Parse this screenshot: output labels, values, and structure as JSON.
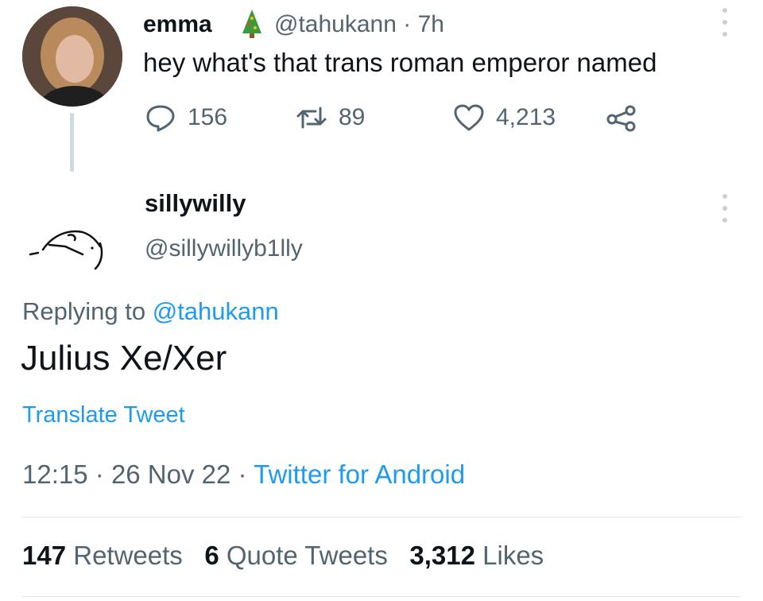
{
  "tweet1": {
    "name": "emma",
    "emoji_icon": "christmas-tree-icon",
    "handle": "@tahukann",
    "separator": "·",
    "age": "7h",
    "text": "hey what's that trans roman emperor named",
    "replies": "156",
    "retweets": "89",
    "likes": "4,213"
  },
  "tweet2": {
    "name": "sillywilly",
    "handle": "@sillywillyb1lly",
    "replying_prefix": "Replying to",
    "replying_handle": "@tahukann",
    "text": "Julius Xe/Xer",
    "translate": "Translate Tweet",
    "time": "12:15",
    "date": "26 Nov 22",
    "source": "Twitter for Android",
    "dot": "·",
    "stats": {
      "retweets_count": "147",
      "retweets_label": "Retweets",
      "quotes_count": "6",
      "quotes_label": "Quote Tweets",
      "likes_count": "3,312",
      "likes_label": "Likes"
    }
  },
  "colors": {
    "link": "#1d9bf0",
    "secondary": "#536471",
    "primary": "#0f1419"
  }
}
